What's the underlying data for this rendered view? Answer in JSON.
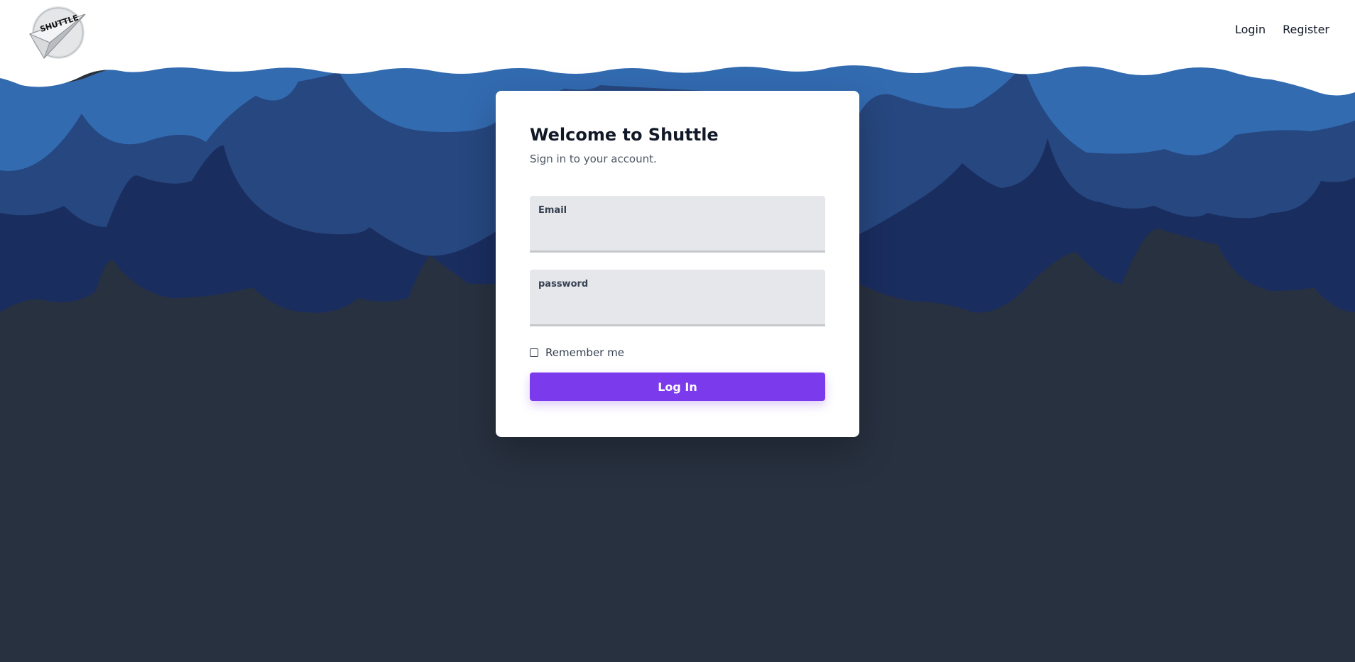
{
  "header": {
    "logo_text": "SHUTTLE",
    "nav": {
      "login_label": "Login",
      "register_label": "Register"
    }
  },
  "login_card": {
    "title": "Welcome to Shuttle",
    "subtitle": "Sign in to your account.",
    "email_label": "Email",
    "email_value": "",
    "password_label": "password",
    "password_value": "",
    "remember_label": "Remember me",
    "remember_checked": false,
    "submit_label": "Log In"
  },
  "colors": {
    "accent": "#7c3aed",
    "cloud_light": "#336bb1",
    "cloud_mid": "#26477f",
    "cloud_dark": "#1a2d5f",
    "background_dark": "#283140"
  },
  "icons": {
    "logo": "shuttle-paper-plane-logo",
    "checkbox": "checkbox-unchecked"
  }
}
